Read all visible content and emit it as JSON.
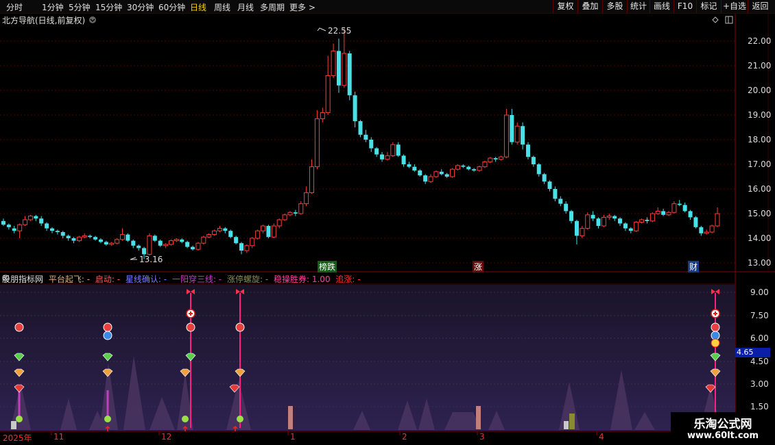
{
  "toolbar": {
    "timeframes": [
      "分时",
      "1分钟",
      "5分钟",
      "15分钟",
      "30分钟",
      "60分钟",
      "日线",
      "周线",
      "月线",
      "多周期",
      "更多 >"
    ],
    "active_timeframe": "日线",
    "right_buttons": [
      "复权",
      "叠加",
      "多股",
      "统计",
      "画线",
      "F10",
      "标记",
      "+自选",
      "返回"
    ]
  },
  "main_chart": {
    "title": "北方导航(日线,前复权)",
    "high_label": "22.55",
    "low_label": "13.16",
    "tags": [
      "榜跌",
      "涨",
      "财"
    ],
    "yticks": [
      "22.00",
      "21.00",
      "20.00",
      "19.00",
      "18.00",
      "17.00",
      "16.00",
      "15.00",
      "14.00",
      "13.00"
    ]
  },
  "indicator_panel": {
    "legend": [
      {
        "text": "股朋指标网",
        "color": "#e0e0e0"
      },
      {
        "text": "平台起飞: -",
        "color": "#d8b080"
      },
      {
        "text": "启动: -",
        "color": "#ff5a5a"
      },
      {
        "text": "星线确认: -",
        "color": "#7b7bff"
      },
      {
        "text": "一阳穿三线: -",
        "color": "#c040c0"
      },
      {
        "text": "涨停螺旋: -",
        "color": "#8a8a5a"
      },
      {
        "text": "稳操胜券: 1.00",
        "color": "#ff40a0"
      },
      {
        "text": "追涨: -",
        "color": "#ff3030"
      }
    ],
    "yticks": [
      "9.00",
      "7.50",
      "6.00",
      "4.50",
      "3.00",
      "1.50"
    ],
    "current_value": "4.65"
  },
  "date_axis": [
    "2025年",
    "11",
    "12",
    "1",
    "2",
    "3",
    "4"
  ],
  "watermark": {
    "line1": "乐淘公式网",
    "line2": "www.60lt.com"
  },
  "chart_data": {
    "type": "candlestick",
    "title": "北方导航(日线,前复权)",
    "xlabel": "",
    "ylabel": "",
    "ylim": [
      12.8,
      22.8
    ],
    "grid": true,
    "candles": [
      [
        14.7,
        14.55,
        14.8,
        14.5
      ],
      [
        14.55,
        14.45,
        14.6,
        14.35
      ],
      [
        14.4,
        14.3,
        14.5,
        14.2
      ],
      [
        14.3,
        14.55,
        14.6,
        14.0
      ],
      [
        14.55,
        14.75,
        14.9,
        14.5
      ],
      [
        14.75,
        14.9,
        14.95,
        14.7
      ],
      [
        14.9,
        14.8,
        14.95,
        14.7
      ],
      [
        14.8,
        14.6,
        14.9,
        14.5
      ],
      [
        14.6,
        14.4,
        14.65,
        14.3
      ],
      [
        14.4,
        14.3,
        14.45,
        14.2
      ],
      [
        14.3,
        14.25,
        14.35,
        14.15
      ],
      [
        14.25,
        14.1,
        14.3,
        14.0
      ],
      [
        14.1,
        14.0,
        14.15,
        13.9
      ],
      [
        14.0,
        13.9,
        14.05,
        13.8
      ],
      [
        13.9,
        14.05,
        14.1,
        13.85
      ],
      [
        14.05,
        14.1,
        14.2,
        14.0
      ],
      [
        14.1,
        14.05,
        14.15,
        14.0
      ],
      [
        14.05,
        13.95,
        14.1,
        13.9
      ],
      [
        13.95,
        13.85,
        14.0,
        13.8
      ],
      [
        13.85,
        13.75,
        13.9,
        13.7
      ],
      [
        13.75,
        13.8,
        13.85,
        13.7
      ],
      [
        13.8,
        13.95,
        14.0,
        13.75
      ],
      [
        13.95,
        14.15,
        14.4,
        13.9
      ],
      [
        14.15,
        13.9,
        14.2,
        13.85
      ],
      [
        13.9,
        13.7,
        13.95,
        13.6
      ],
      [
        13.7,
        13.6,
        13.75,
        13.5
      ],
      [
        13.6,
        13.35,
        13.65,
        13.16
      ],
      [
        13.35,
        14.1,
        14.2,
        13.3
      ],
      [
        14.1,
        13.9,
        14.15,
        13.85
      ],
      [
        13.9,
        13.7,
        13.95,
        13.65
      ],
      [
        13.7,
        13.75,
        13.8,
        13.6
      ],
      [
        13.75,
        13.9,
        13.95,
        13.7
      ],
      [
        13.9,
        13.95,
        14.0,
        13.85
      ],
      [
        13.95,
        13.85,
        14.0,
        13.8
      ],
      [
        13.85,
        13.65,
        13.9,
        13.6
      ],
      [
        13.65,
        13.55,
        13.7,
        13.5
      ],
      [
        13.55,
        13.8,
        13.85,
        13.5
      ],
      [
        13.8,
        14.05,
        14.1,
        13.75
      ],
      [
        14.05,
        14.15,
        14.2,
        14.0
      ],
      [
        14.15,
        14.3,
        14.35,
        14.1
      ],
      [
        14.3,
        14.4,
        14.5,
        14.25
      ],
      [
        14.4,
        14.3,
        14.45,
        14.2
      ],
      [
        14.3,
        14.05,
        14.35,
        14.0
      ],
      [
        14.05,
        13.8,
        14.1,
        13.75
      ],
      [
        13.8,
        13.5,
        13.85,
        13.35
      ],
      [
        13.5,
        13.7,
        13.75,
        13.4
      ],
      [
        13.7,
        14.0,
        14.05,
        13.6
      ],
      [
        14.0,
        14.3,
        14.35,
        13.95
      ],
      [
        14.3,
        14.5,
        14.55,
        14.2
      ],
      [
        14.5,
        14.05,
        14.55,
        14.0
      ],
      [
        14.05,
        14.5,
        14.6,
        14.0
      ],
      [
        14.5,
        14.75,
        14.8,
        14.4
      ],
      [
        14.75,
        14.95,
        15.0,
        14.7
      ],
      [
        14.95,
        15.05,
        15.1,
        14.9
      ],
      [
        15.05,
        15.0,
        15.15,
        14.9
      ],
      [
        15.0,
        15.4,
        15.5,
        14.95
      ],
      [
        15.4,
        15.85,
        16.1,
        15.3
      ],
      [
        15.85,
        16.9,
        17.2,
        15.8
      ],
      [
        16.9,
        18.85,
        19.2,
        16.8
      ],
      [
        18.85,
        19.1,
        19.3,
        18.7
      ],
      [
        19.1,
        20.6,
        21.4,
        19.0
      ],
      [
        20.6,
        21.6,
        21.9,
        20.5
      ],
      [
        21.6,
        20.2,
        22.1,
        19.9
      ],
      [
        20.2,
        21.5,
        22.55,
        20.1
      ],
      [
        21.5,
        19.8,
        21.6,
        19.6
      ],
      [
        19.8,
        18.75,
        19.95,
        18.5
      ],
      [
        18.75,
        18.2,
        18.8,
        18.1
      ],
      [
        18.2,
        18.0,
        18.4,
        17.9
      ],
      [
        18.0,
        17.65,
        18.1,
        17.5
      ],
      [
        17.65,
        17.4,
        17.7,
        17.3
      ],
      [
        17.4,
        17.2,
        17.5,
        17.1
      ],
      [
        17.2,
        17.35,
        17.5,
        17.15
      ],
      [
        17.35,
        17.8,
        17.9,
        17.3
      ],
      [
        17.8,
        17.35,
        17.9,
        17.3
      ],
      [
        17.35,
        17.0,
        17.4,
        16.9
      ],
      [
        17.0,
        16.9,
        17.1,
        16.85
      ],
      [
        16.9,
        16.75,
        17.0,
        16.7
      ],
      [
        16.75,
        16.55,
        16.8,
        16.5
      ],
      [
        16.55,
        16.3,
        16.6,
        16.2
      ],
      [
        16.3,
        16.5,
        16.6,
        16.25
      ],
      [
        16.5,
        16.7,
        16.75,
        16.45
      ],
      [
        16.7,
        16.6,
        16.8,
        16.55
      ],
      [
        16.6,
        16.5,
        16.65,
        16.45
      ],
      [
        16.5,
        16.8,
        16.85,
        16.45
      ],
      [
        16.8,
        16.95,
        17.0,
        16.75
      ],
      [
        16.95,
        16.9,
        17.0,
        16.85
      ],
      [
        16.9,
        16.8,
        16.95,
        16.75
      ],
      [
        16.8,
        16.75,
        16.85,
        16.7
      ],
      [
        16.75,
        16.9,
        16.95,
        16.7
      ],
      [
        16.9,
        17.1,
        17.15,
        16.85
      ],
      [
        17.1,
        17.25,
        17.3,
        17.05
      ],
      [
        17.25,
        17.2,
        17.3,
        17.1
      ],
      [
        17.2,
        17.3,
        17.35,
        17.15
      ],
      [
        17.3,
        19.0,
        19.25,
        17.25
      ],
      [
        19.0,
        17.9,
        19.25,
        17.8
      ],
      [
        17.9,
        18.55,
        18.7,
        17.8
      ],
      [
        18.55,
        17.8,
        18.7,
        17.6
      ],
      [
        17.8,
        17.3,
        17.9,
        17.2
      ],
      [
        17.3,
        17.0,
        17.35,
        16.9
      ],
      [
        17.0,
        16.6,
        17.05,
        16.5
      ],
      [
        16.6,
        16.3,
        16.65,
        16.2
      ],
      [
        16.3,
        16.0,
        16.35,
        15.9
      ],
      [
        16.0,
        15.6,
        16.1,
        15.5
      ],
      [
        15.6,
        15.4,
        15.7,
        15.3
      ],
      [
        15.4,
        15.1,
        15.5,
        15.0
      ],
      [
        15.1,
        14.7,
        15.15,
        14.6
      ],
      [
        14.7,
        14.1,
        14.75,
        13.75
      ],
      [
        14.1,
        14.4,
        14.5,
        14.0
      ],
      [
        14.4,
        14.95,
        15.05,
        14.35
      ],
      [
        14.95,
        14.8,
        15.1,
        14.7
      ],
      [
        14.8,
        14.5,
        14.85,
        14.4
      ],
      [
        14.5,
        14.85,
        14.95,
        14.45
      ],
      [
        14.85,
        14.9,
        15.0,
        14.75
      ],
      [
        14.9,
        14.8,
        14.95,
        14.7
      ],
      [
        14.8,
        14.6,
        14.85,
        14.5
      ],
      [
        14.6,
        14.4,
        14.65,
        14.3
      ],
      [
        14.4,
        14.3,
        14.45,
        14.2
      ],
      [
        14.3,
        14.65,
        14.7,
        14.25
      ],
      [
        14.65,
        14.75,
        14.8,
        14.6
      ],
      [
        14.75,
        14.7,
        14.85,
        14.6
      ],
      [
        14.7,
        15.0,
        15.05,
        14.65
      ],
      [
        15.0,
        15.1,
        15.25,
        14.95
      ],
      [
        15.1,
        14.95,
        15.2,
        14.9
      ],
      [
        14.95,
        15.05,
        15.1,
        14.9
      ],
      [
        15.05,
        15.4,
        15.5,
        15.0
      ],
      [
        15.4,
        15.35,
        15.55,
        15.3
      ],
      [
        15.35,
        15.1,
        15.45,
        15.05
      ],
      [
        15.1,
        14.85,
        15.15,
        14.75
      ],
      [
        14.85,
        14.45,
        14.9,
        14.4
      ],
      [
        14.45,
        14.2,
        14.5,
        14.1
      ],
      [
        14.2,
        14.25,
        14.35,
        14.15
      ],
      [
        14.25,
        14.5,
        14.55,
        14.2
      ],
      [
        14.5,
        15.0,
        15.25,
        14.45
      ]
    ]
  }
}
